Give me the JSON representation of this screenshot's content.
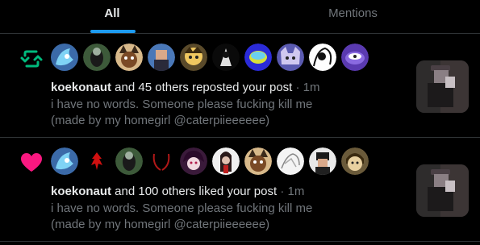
{
  "tabs": [
    {
      "label": "All",
      "active": true
    },
    {
      "label": "Mentions",
      "active": false
    }
  ],
  "accent_color": "#1d9bf0",
  "notifications": [
    {
      "type_icon": "repost-icon",
      "icon_color": "#00ba7c",
      "user": "koekonaut",
      "action": " and 45 others reposted your post",
      "dot": " · ",
      "time": "1m",
      "text_line1": "i have no words. Someone please fucking kill me",
      "text_line2": "(made by my homegirl @caterpiieeeeee)"
    },
    {
      "type_icon": "heart-icon",
      "icon_color": "#f91880",
      "user": "koekonaut",
      "action": " and 100 others liked your post",
      "dot": " · ",
      "time": "1m",
      "text_line1": "i have no words. Someone please fucking kill me",
      "text_line2": "(made by my homegirl @caterpiieeeeee)"
    }
  ]
}
